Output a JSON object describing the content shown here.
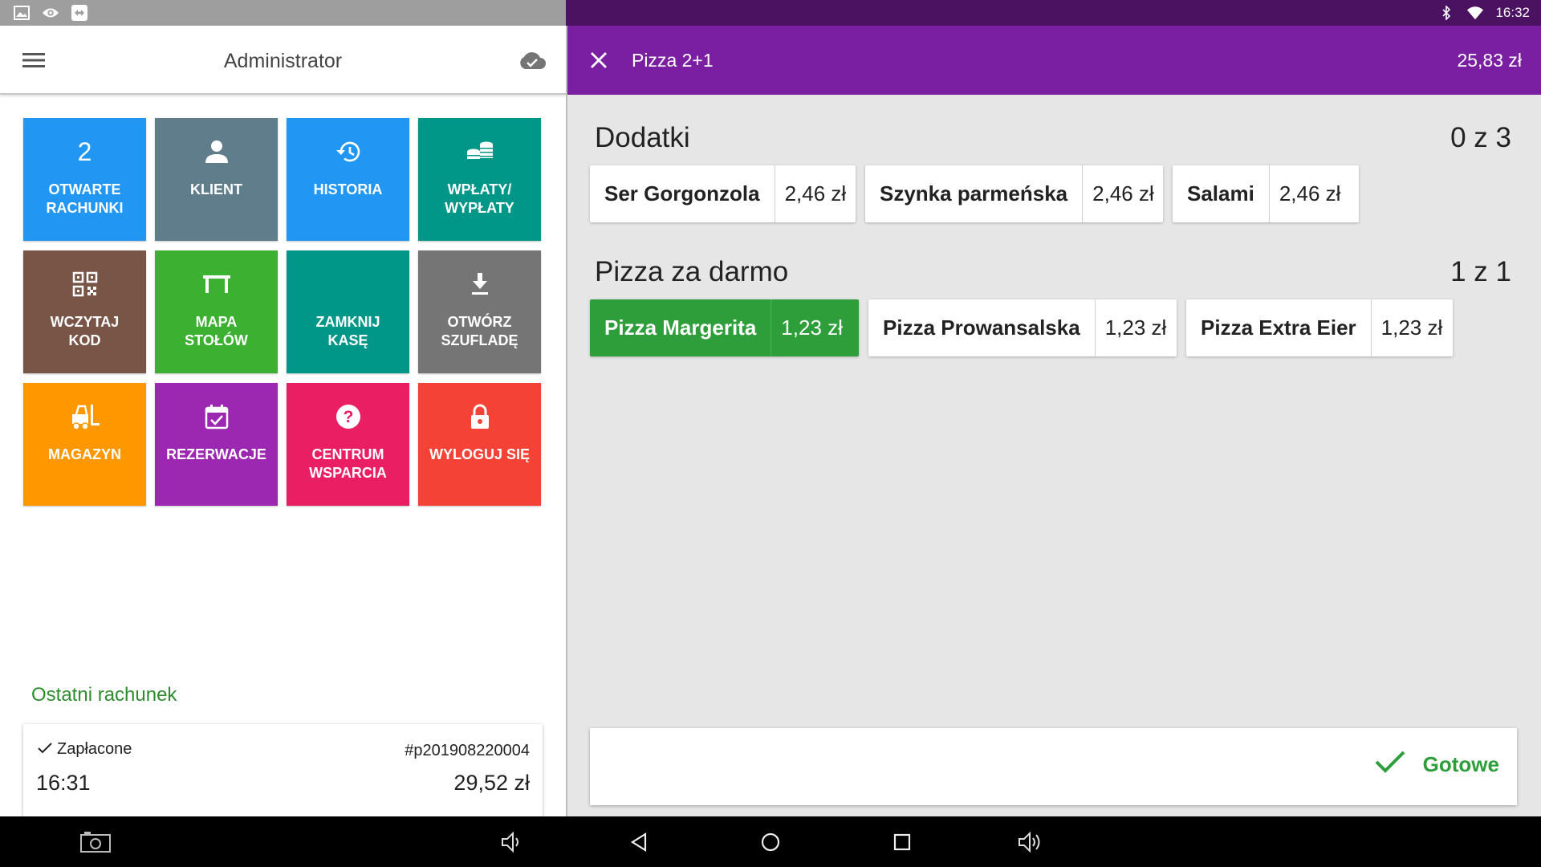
{
  "status_bar": {
    "time": "16:32",
    "left_icons": [
      "image-icon",
      "eye-icon",
      "teamviewer-icon"
    ],
    "right_icons": [
      "bluetooth-icon",
      "wifi-icon"
    ]
  },
  "left_header": {
    "title": "Administrator",
    "menu_icon": "hamburger-menu-icon",
    "sync_icon": "cloud-check-icon"
  },
  "tiles": [
    {
      "name": "open-bills",
      "icon": "2",
      "label": "OTWARTE\nRACHUNKI",
      "color": "#2196f3"
    },
    {
      "name": "client",
      "icon": "person-icon",
      "label": "KLIENT",
      "color": "#5f7d8b"
    },
    {
      "name": "history",
      "icon": "history-icon",
      "label": "HISTORIA",
      "color": "#2196f3"
    },
    {
      "name": "deposits-withdrawals",
      "icon": "coins-icon",
      "label": "WPŁATY/\nWYPŁATY",
      "color": "#009688"
    },
    {
      "name": "scan-code",
      "icon": "qr-code-icon",
      "label": "WCZYTAJ\nKOD",
      "color": "#795548"
    },
    {
      "name": "table-map",
      "icon": "table-icon",
      "label": "MAPA\nSTOŁÓW",
      "color": "#3cb031"
    },
    {
      "name": "close-register",
      "icon": "",
      "label": "ZAMKNIJ\nKASĘ",
      "color": "#009688"
    },
    {
      "name": "open-drawer",
      "icon": "download-icon",
      "label": "OTWÓRZ\nSZUFLADĘ",
      "color": "#757575"
    },
    {
      "name": "warehouse",
      "icon": "forklift-icon",
      "label": "MAGAZYN",
      "color": "#ff9800"
    },
    {
      "name": "reservations",
      "icon": "calendar-check-icon",
      "label": "REZERWACJE",
      "color": "#9c27b0"
    },
    {
      "name": "support-center",
      "icon": "help-icon",
      "label": "CENTRUM\nWSPARCIA",
      "color": "#e91e63"
    },
    {
      "name": "logout",
      "icon": "lock-icon",
      "label": "WYLOGUJ SIĘ",
      "color": "#f44336"
    }
  ],
  "last_receipt": {
    "section_title": "Ostatni rachunek",
    "status": "Zapłacone",
    "number": "#p201908220004",
    "time": "16:31",
    "amount": "29,52 zł"
  },
  "right_header": {
    "title": "Pizza 2+1",
    "total": "25,83 zł"
  },
  "groups": [
    {
      "title": "Dodatki",
      "count": "0 z 3",
      "options": [
        {
          "name": "Ser Gorgonzola",
          "price": "2,46 zł",
          "selected": false
        },
        {
          "name": "Szynka parmeńska",
          "price": "2,46 zł",
          "selected": false
        },
        {
          "name": "Salami",
          "price": "2,46 zł",
          "selected": false
        }
      ]
    },
    {
      "title": "Pizza za darmo",
      "count": "1 z 1",
      "options": [
        {
          "name": "Pizza Margerita",
          "price": "1,23 zł",
          "selected": true
        },
        {
          "name": "Pizza Prowansalska",
          "price": "1,23 zł",
          "selected": false
        },
        {
          "name": "Pizza Extra Eier",
          "price": "1,23 zł",
          "selected": false
        }
      ]
    }
  ],
  "done_button": {
    "label": "Gotowe"
  },
  "accent_colors": {
    "purple": "#7b1fa2",
    "green": "#2e9e3a"
  }
}
